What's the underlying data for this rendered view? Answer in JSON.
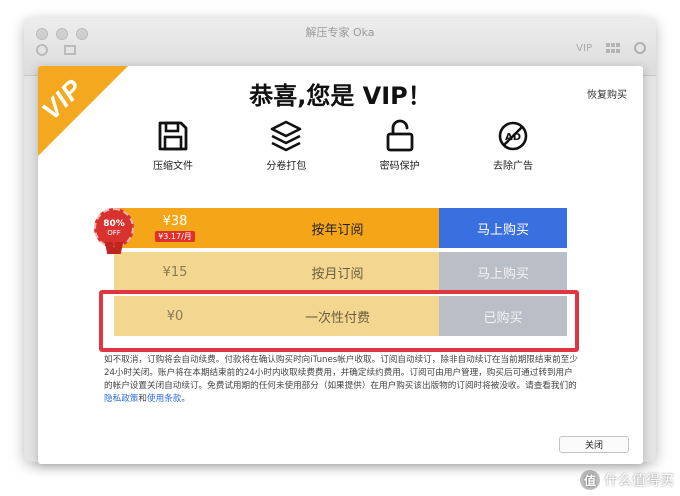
{
  "background_window": {
    "title": "解压专家 Oka",
    "tools": [
      "VIP",
      "更多应用"
    ]
  },
  "dialog": {
    "corner_badge": "VIP",
    "title": "恭喜,您是 VIP！",
    "restore_label": "恢复购买",
    "features": [
      {
        "icon": "save-icon",
        "label": "压缩文件"
      },
      {
        "icon": "layers-icon",
        "label": "分卷打包"
      },
      {
        "icon": "unlock-icon",
        "label": "密码保护"
      },
      {
        "icon": "ad-remove-icon",
        "label": "去除广告"
      }
    ],
    "discount_badge": {
      "percent": "80%",
      "text": "OFF"
    },
    "plans": [
      {
        "price": "¥38",
        "per_month": "¥3.17/月",
        "name": "按年订阅",
        "action": "马上购买"
      },
      {
        "price": "¥15",
        "name": "按月订阅",
        "action": "马上购买"
      },
      {
        "price": "¥0",
        "name": "一次性付费",
        "action": "已购买"
      }
    ],
    "terms_part1": "如不取消，订购将会自动续费。付款将在确认购买时向iTunes帐户收取。订阅自动续订，除非自动续订在当前期限结束前至少24小时关闭。账户将在本期结束前的24小时内收取续费费用，并确定续约费用。订阅可由用户管理，购买后可通过转到用户的帐户设置关闭自动续订。免费试用期的任何未使用部分（如果提供）在用户购买该出版物的订阅时将被没收。请查看我们的",
    "privacy_link": "隐私政策",
    "terms_and": "和",
    "terms_link": "使用条款",
    "terms_end": "。",
    "close_label": "关闭"
  },
  "watermark": {
    "text": "什么值得买",
    "logo": "值"
  },
  "colors": {
    "accent_orange": "#f5a518",
    "buy_blue": "#3a6fe0",
    "highlight_red": "#e03641"
  }
}
